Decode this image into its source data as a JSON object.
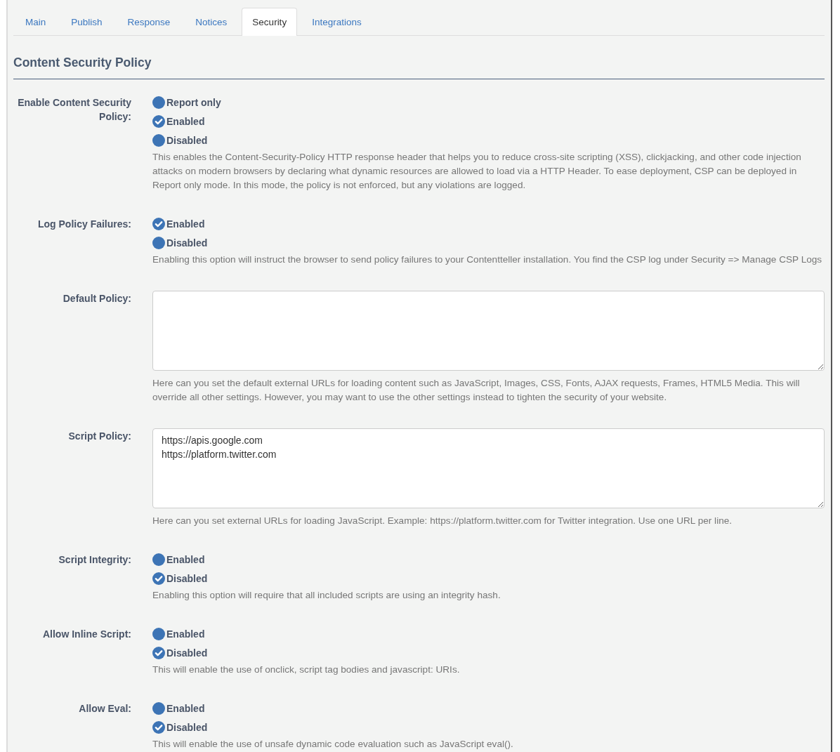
{
  "tabs": [
    {
      "label": "Main",
      "selected": false
    },
    {
      "label": "Publish",
      "selected": false
    },
    {
      "label": "Response",
      "selected": false
    },
    {
      "label": "Notices",
      "selected": false
    },
    {
      "label": "Security",
      "selected": true
    },
    {
      "label": "Integrations",
      "selected": false
    }
  ],
  "section": {
    "title": "Content Security Policy"
  },
  "fields": [
    {
      "kind": "radio",
      "label": "Enable Content Security Policy:",
      "options": [
        {
          "label": "Report only",
          "selected": false
        },
        {
          "label": "Enabled",
          "selected": true
        },
        {
          "label": "Disabled",
          "selected": false
        }
      ],
      "help": "This enables the Content-Security-Policy HTTP response header that helps you to reduce cross-site scripting (XSS), clickjacking, and other code injection attacks on modern browsers by declaring what dynamic resources are allowed to load via a HTTP Header. To ease deployment, CSP can be deployed in Report only mode. In this mode, the policy is not enforced, but any violations are logged."
    },
    {
      "kind": "radio",
      "label": "Log Policy Failures:",
      "options": [
        {
          "label": "Enabled",
          "selected": true
        },
        {
          "label": "Disabled",
          "selected": false
        }
      ],
      "help": "Enabling this option will instruct the browser to send policy failures to your Contentteller installation. You find the CSP log under Security => Manage CSP Logs"
    },
    {
      "kind": "textarea",
      "label": "Default Policy:",
      "help": "Here can you set the default external URLs for loading content such as JavaScript, Images, CSS, Fonts, AJAX requests, Frames, HTML5 Media. This will override all other settings. However, you may want to use the other settings instead to tighten the security of your website."
    },
    {
      "kind": "textarea",
      "label": "Script Policy:",
      "value": "https://apis.google.com\nhttps://platform.twitter.com",
      "help": "Here can you set external URLs for loading JavaScript. Example: https://platform.twitter.com for Twitter integration. Use one URL per line."
    },
    {
      "kind": "radio",
      "label": "Script Integrity:",
      "options": [
        {
          "label": "Enabled",
          "selected": false
        },
        {
          "label": "Disabled",
          "selected": true
        }
      ],
      "help": "Enabling this option will require that all included scripts are using an integrity hash."
    },
    {
      "kind": "radio",
      "label": "Allow Inline Script:",
      "options": [
        {
          "label": "Enabled",
          "selected": false
        },
        {
          "label": "Disabled",
          "selected": true
        }
      ],
      "help": "This will enable the use of onclick, script tag bodies and javascript: URIs."
    },
    {
      "kind": "radio",
      "label": "Allow Eval:",
      "options": [
        {
          "label": "Enabled",
          "selected": false
        },
        {
          "label": "Disabled",
          "selected": true
        }
      ],
      "help": "This will enable the use of unsafe dynamic code evaluation such as JavaScript eval()."
    }
  ]
}
